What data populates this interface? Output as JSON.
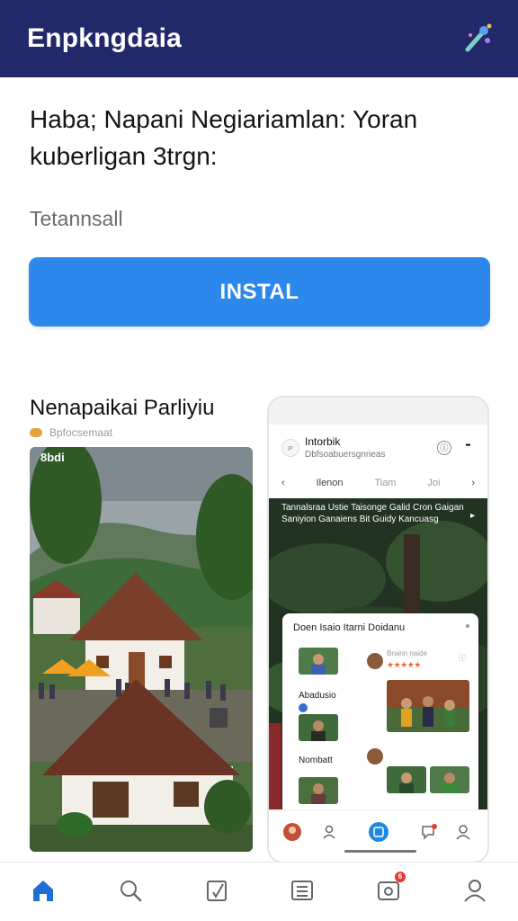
{
  "appbar": {
    "title": "Enpkngdaia",
    "icon": "magic-wand-icon"
  },
  "headline": "Haba; Napani Negiariamlan: Yoran kuberligan 3trgn:",
  "subtitle": "Tetannsall",
  "install_label": "INSTAL",
  "section": {
    "title": "Nenapaikai Parliyiu",
    "subtitle": "Bpfocsemaat",
    "scene_badge": "8bdi"
  },
  "phone": {
    "title": "Intorbik",
    "subtitle": "Dbfsoabuersgnrieas",
    "icon1": "ⓘ",
    "icon2": "••",
    "tabs": [
      "Ilenon",
      "Tiam",
      "Joi"
    ],
    "caption": "Tannalsraa Ustie Taisonge Galid Cron Gaigan Saniyion Ganaiens Bit Guidy Kancuasg",
    "card": {
      "title": "Doen Isaio Itarni Doidanu",
      "rows": [
        {
          "label": "Abadusio"
        },
        {
          "label": "Nombatt"
        }
      ],
      "stars": "★★★★★",
      "meta": "Brainn naide"
    }
  },
  "bottomnav": {
    "items": [
      "home-icon",
      "search-icon",
      "edit-icon",
      "list-icon",
      "notifications-icon",
      "profile-icon"
    ],
    "notification_count": "6"
  },
  "colors": {
    "appbar": "#22296b",
    "accent": "#2c88ea",
    "nav_active": "#1f6fd6"
  }
}
